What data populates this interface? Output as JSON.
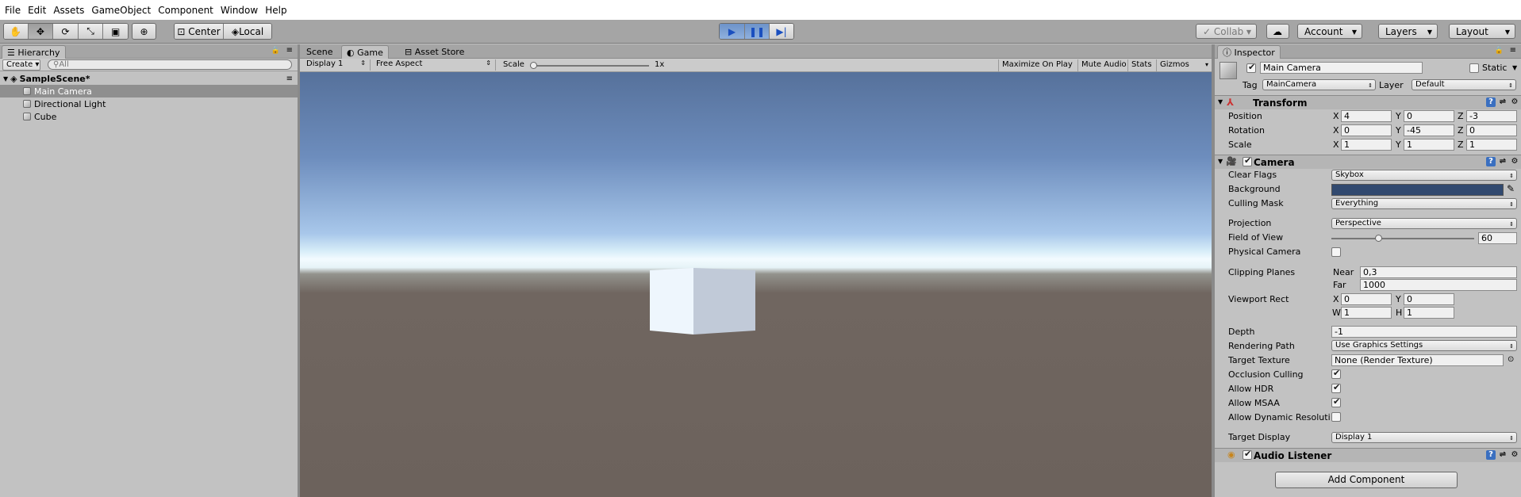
{
  "menu": [
    "File",
    "Edit",
    "Assets",
    "GameObject",
    "Component",
    "Window",
    "Help"
  ],
  "toolbar": {
    "pivot": "Center",
    "space": "Local",
    "collab": "Collab",
    "account": "Account",
    "layers": "Layers",
    "layout": "Layout"
  },
  "hierarchy": {
    "tab": "Hierarchy",
    "create": "Create",
    "search_placeholder": "All",
    "scene": "SampleScene*",
    "items": [
      "Main Camera",
      "Directional Light",
      "Cube"
    ]
  },
  "game": {
    "tabs": [
      "Scene",
      "Game",
      "Asset Store"
    ],
    "display": "Display 1",
    "aspect": "Free Aspect",
    "scale_label": "Scale",
    "scale_value": "1x",
    "maximize": "Maximize On Play",
    "mute": "Mute Audio",
    "stats": "Stats",
    "gizmos": "Gizmos"
  },
  "inspector": {
    "tab": "Inspector",
    "name": "Main Camera",
    "static": "Static",
    "tag_label": "Tag",
    "tag": "MainCamera",
    "layer_label": "Layer",
    "layer": "Default",
    "transform": {
      "title": "Transform",
      "position_label": "Position",
      "rotation_label": "Rotation",
      "scale_label": "Scale",
      "position": [
        "4",
        "0",
        "-3"
      ],
      "rotation": [
        "0",
        "-45",
        "0"
      ],
      "scale": [
        "1",
        "1",
        "1"
      ]
    },
    "camera": {
      "title": "Camera",
      "clear_flags_label": "Clear Flags",
      "clear_flags": "Skybox",
      "background_label": "Background",
      "background_color": "#31496f",
      "culling_mask_label": "Culling Mask",
      "culling_mask": "Everything",
      "projection_label": "Projection",
      "projection": "Perspective",
      "fov_label": "Field of View",
      "fov": "60",
      "fov_fraction": 0.33,
      "physical_label": "Physical Camera",
      "clipping_label": "Clipping Planes",
      "near_label": "Near",
      "near": "0,3",
      "far_label": "Far",
      "far": "1000",
      "viewport_label": "Viewport Rect",
      "vx": "0",
      "vy": "0",
      "vw": "1",
      "vh": "1",
      "depth_label": "Depth",
      "depth": "-1",
      "rendering_path_label": "Rendering Path",
      "rendering_path": "Use Graphics Settings",
      "target_texture_label": "Target Texture",
      "target_texture": "None (Render Texture)",
      "occlusion_label": "Occlusion Culling",
      "hdr_label": "Allow HDR",
      "msaa_label": "Allow MSAA",
      "dynres_label": "Allow Dynamic Resoluti",
      "target_display_label": "Target Display",
      "target_display": "Display 1"
    },
    "audio_listener": "Audio Listener",
    "add_component": "Add Component",
    "axis": {
      "x": "X",
      "y": "Y",
      "z": "Z",
      "w": "W",
      "h": "H"
    }
  }
}
